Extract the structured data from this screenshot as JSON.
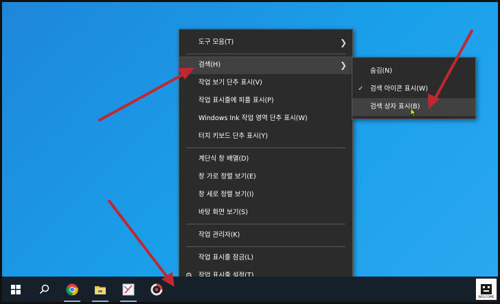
{
  "main_menu": {
    "items": [
      {
        "label": "도구 모음(T)"
      },
      {
        "label": "검색(H)"
      },
      {
        "label": "작업 보기 단추 표시(V)"
      },
      {
        "label": "작업 표시줄에 피플 표시(P)"
      },
      {
        "label": "Windows Ink 작업 영역 단추 표시(W)"
      },
      {
        "label": "터치 키보드 단추 표시(Y)"
      },
      {
        "label": "계단식 창 배열(D)"
      },
      {
        "label": "창 가로 정렬 보기(E)"
      },
      {
        "label": "창 세로 정렬 보기(I)"
      },
      {
        "label": "바탕 화면 보기(S)"
      },
      {
        "label": "작업 관리자(K)"
      },
      {
        "label": "작업 표시줄 잠금(L)"
      },
      {
        "label": "작업 표시줄 설정(T)"
      }
    ]
  },
  "search_submenu": {
    "items": [
      {
        "label": "숨김(N)"
      },
      {
        "label": "검색 아이콘 표시(W)",
        "checked": true
      },
      {
        "label": "검색 상자 표시(B)"
      }
    ]
  },
  "taskbar": {
    "icons": [
      "windows-start-icon",
      "search-icon",
      "chrome-icon",
      "file-explorer-icon",
      "paint-app-icon",
      "recorder-app-icon"
    ]
  },
  "watermark": {
    "label": "WELCOME"
  },
  "colors": {
    "desktop": "#1f8fde",
    "menu_bg": "#2b2b2b",
    "highlight": "#414141",
    "taskbar": "#16202a",
    "arrow": "#c0282f"
  }
}
